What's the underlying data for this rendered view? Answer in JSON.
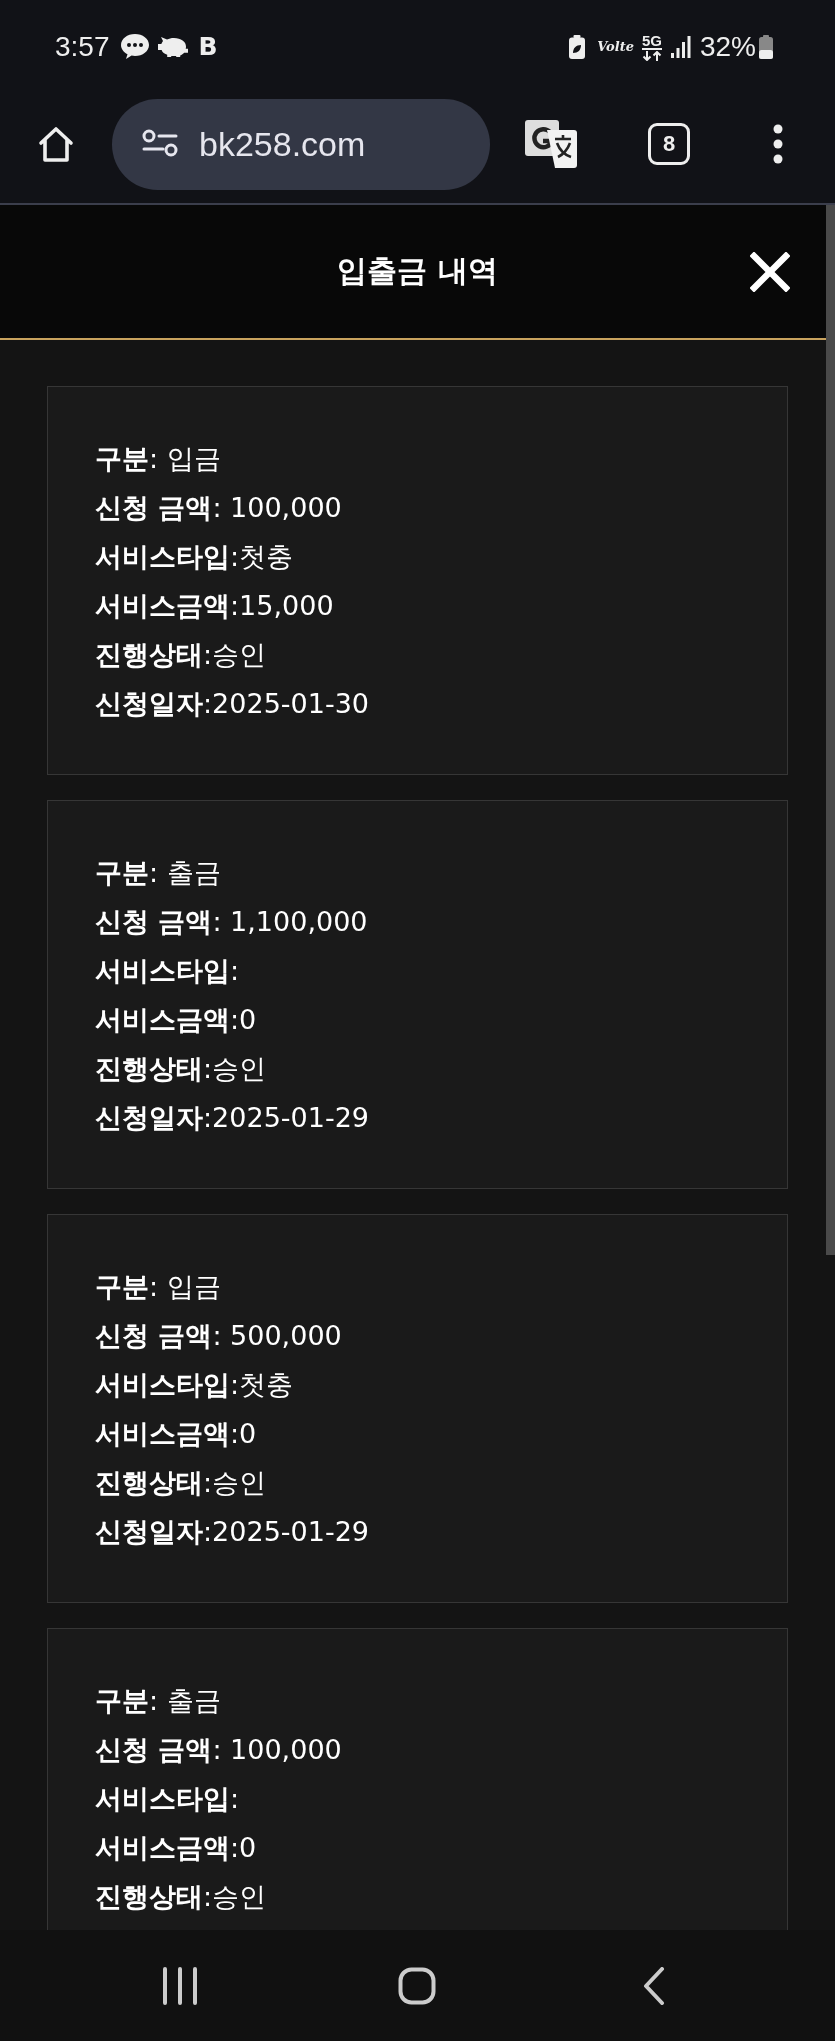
{
  "status_bar": {
    "time": "3:57",
    "app_letter": "B",
    "volte": "Volte",
    "network": "5G",
    "battery": "32%"
  },
  "browser": {
    "url": "bk258.com",
    "tab_count": "8"
  },
  "header": {
    "title": "입출금 내역"
  },
  "records": [
    {
      "lines": [
        "**구분**: 입금",
        "**신청 금액**: 100,000",
        "**서비스타입**:첫충",
        "**서비스금액**:15,000",
        "**진행상태**:승인",
        "**신청일자**:2025-01-30"
      ]
    },
    {
      "lines": [
        "**구분**: 출금",
        "**신청 금액**: 1,100,000",
        "**서비스타입**:",
        "**서비스금액**:0",
        "**진행상태**:승인",
        "**신청일자**:2025-01-29"
      ]
    },
    {
      "lines": [
        "**구분**: 입금",
        "**신청 금액**: 500,000",
        "**서비스타입**:첫충",
        "**서비스금액**:0",
        "**진행상태**:승인",
        "**신청일자**:2025-01-29"
      ]
    },
    {
      "lines": [
        "**구분**: 출금",
        "**신청 금액**: 100,000",
        "**서비스타입**:",
        "**서비스금액**:0",
        "**진행상태**:승인"
      ]
    }
  ]
}
